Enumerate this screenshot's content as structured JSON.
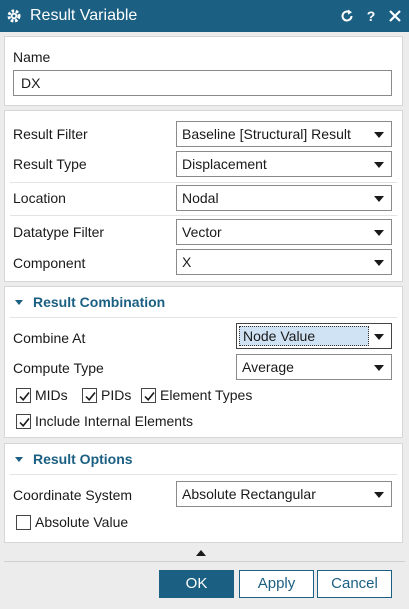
{
  "window": {
    "title": "Result Variable",
    "icons": {
      "app": "gear-icon",
      "reset": "reset-icon",
      "help": "help-icon",
      "close": "close-icon"
    },
    "help_label": "?"
  },
  "name": {
    "label": "Name",
    "value": "DX"
  },
  "filters": {
    "result_filter": {
      "label": "Result Filter",
      "value": "Baseline [Structural] Result"
    },
    "result_type": {
      "label": "Result Type",
      "value": "Displacement"
    },
    "location": {
      "label": "Location",
      "value": "Nodal"
    },
    "datatype_filter": {
      "label": "Datatype Filter",
      "value": "Vector"
    },
    "component": {
      "label": "Component",
      "value": "X"
    }
  },
  "result_combination": {
    "header": "Result Combination",
    "combine_at": {
      "label": "Combine At",
      "value": "Node Value"
    },
    "compute_type": {
      "label": "Compute Type",
      "value": "Average"
    },
    "mids": {
      "label": "MIDs",
      "checked": true
    },
    "pids": {
      "label": "PIDs",
      "checked": true
    },
    "element_types": {
      "label": "Element Types",
      "checked": true
    },
    "include_internal": {
      "label": "Include Internal Elements",
      "checked": true
    }
  },
  "result_options": {
    "header": "Result Options",
    "coordinate_system": {
      "label": "Coordinate System",
      "value": "Absolute Rectangular"
    },
    "absolute_value": {
      "label": "Absolute Value",
      "checked": false
    }
  },
  "buttons": {
    "ok": "OK",
    "apply": "Apply",
    "cancel": "Cancel"
  },
  "colors": {
    "accent": "#1b5f82",
    "selection": "#cfe3f4"
  }
}
